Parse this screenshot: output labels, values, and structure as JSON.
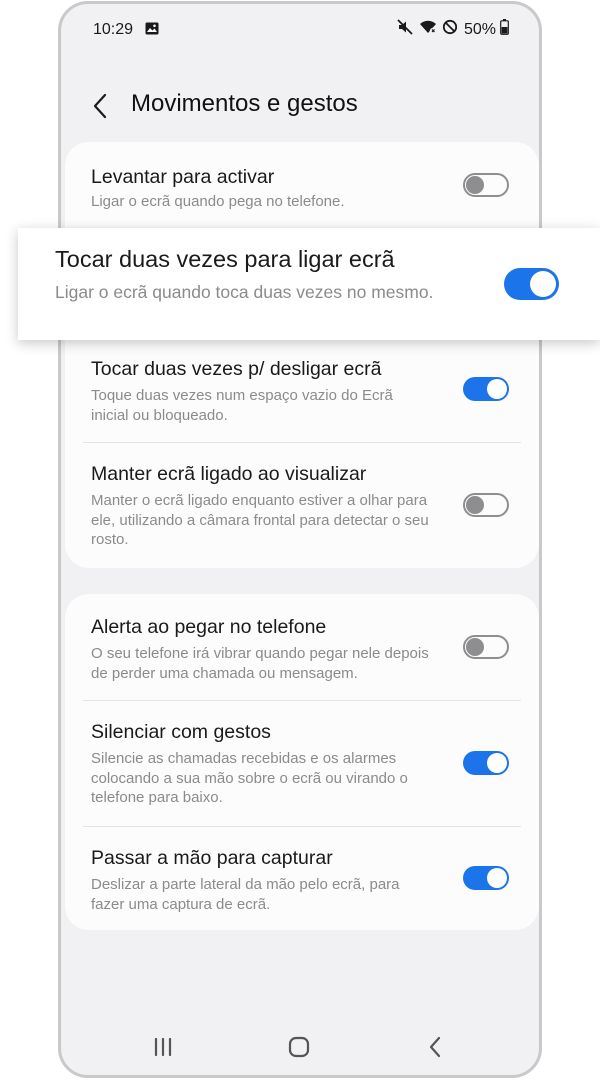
{
  "status": {
    "time": "10:29",
    "battery": "50%"
  },
  "header": {
    "title": "Movimentos e gestos"
  },
  "settings": [
    {
      "title": "Levantar para activar",
      "subtitle": "Ligar o ecrã quando pega no telefone.",
      "on": false
    },
    {
      "title": "Tocar duas vezes para ligar ecrã",
      "subtitle": "Ligar o ecrã quando toca duas vezes no mesmo.",
      "on": true
    },
    {
      "title": "Tocar duas vezes p/ desligar ecrã",
      "subtitle": "Toque duas vezes num espaço vazio do Ecrã inicial ou bloqueado.",
      "on": true
    },
    {
      "title": "Manter ecrã ligado ao visualizar",
      "subtitle": "Manter o ecrã ligado enquanto estiver a olhar para ele, utilizando a câmara frontal para detectar o seu rosto.",
      "on": false
    },
    {
      "title": "Alerta ao pegar no telefone",
      "subtitle": "O seu telefone irá vibrar quando pegar nele depois de perder uma chamada ou mensagem.",
      "on": false
    },
    {
      "title": "Silenciar com gestos",
      "subtitle": "Silencie as chamadas recebidas e os alarmes colocando a sua mão sobre o ecrã ou virando o telefone para baixo.",
      "on": true
    },
    {
      "title": "Passar a mão para capturar",
      "subtitle": "Deslizar a parte lateral da mão pelo ecrã, para fazer uma captura de ecrã.",
      "on": true
    }
  ],
  "colors": {
    "accent": "#1c74eb",
    "toggle_off": "#8e8e90",
    "background": "#f1f1f3",
    "card": "#fcfcfc"
  },
  "icons": {
    "status": [
      "gallery-icon",
      "mute-icon",
      "wifi-icon",
      "dnd-icon",
      "battery-icon"
    ],
    "nav": [
      "recent-apps-icon",
      "home-icon",
      "back-icon"
    ]
  }
}
